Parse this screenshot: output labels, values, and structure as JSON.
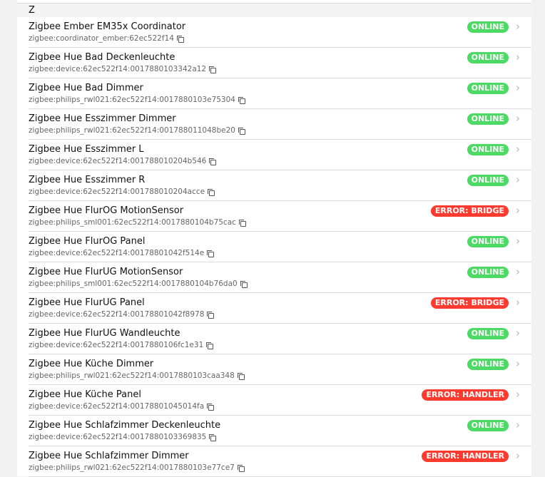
{
  "group_label": "Z",
  "colors": {
    "online": "#4cd964",
    "error": "#ff3b30"
  },
  "rows": [
    {
      "name": "Zigbee Ember EM35x Coordinator",
      "id": "zigbee:coordinator_ember:62ec522f14",
      "status": "ONLINE"
    },
    {
      "name": "Zigbee Hue Bad Deckenleuchte",
      "id": "zigbee:device:62ec522f14:0017880103342a12",
      "status": "ONLINE"
    },
    {
      "name": "Zigbee Hue Bad Dimmer",
      "id": "zigbee:philips_rwl021:62ec522f14:0017880103e75304",
      "status": "ONLINE"
    },
    {
      "name": "Zigbee Hue Esszimmer Dimmer",
      "id": "zigbee:philips_rwl021:62ec522f14:001788011048be20",
      "status": "ONLINE"
    },
    {
      "name": "Zigbee Hue Esszimmer L",
      "id": "zigbee:device:62ec522f14:001788010204b546",
      "status": "ONLINE"
    },
    {
      "name": "Zigbee Hue Esszimmer R",
      "id": "zigbee:device:62ec522f14:001788010204acce",
      "status": "ONLINE"
    },
    {
      "name": "Zigbee Hue FlurOG MotionSensor",
      "id": "zigbee:philips_sml001:62ec522f14:0017880104b75cac",
      "status": "ERROR: BRIDGE"
    },
    {
      "name": "Zigbee Hue FlurOG Panel",
      "id": "zigbee:device:62ec522f14:00178801042f514e",
      "status": "ONLINE"
    },
    {
      "name": "Zigbee Hue FlurUG MotionSensor",
      "id": "zigbee:philips_sml001:62ec522f14:0017880104b76da0",
      "status": "ONLINE"
    },
    {
      "name": "Zigbee Hue FlurUG Panel",
      "id": "zigbee:device:62ec522f14:00178801042f8978",
      "status": "ERROR: BRIDGE"
    },
    {
      "name": "Zigbee Hue FlurUG Wandleuchte",
      "id": "zigbee:device:62ec522f14:0017880106fc1e31",
      "status": "ONLINE"
    },
    {
      "name": "Zigbee Hue Küche Dimmer",
      "id": "zigbee:philips_rwl021:62ec522f14:0017880103caa348",
      "status": "ONLINE"
    },
    {
      "name": "Zigbee Hue Küche Panel",
      "id": "zigbee:device:62ec522f14:00178801045014fa",
      "status": "ERROR: HANDLER"
    },
    {
      "name": "Zigbee Hue Schlafzimmer Deckenleuchte",
      "id": "zigbee:device:62ec522f14:0017880103369835",
      "status": "ONLINE"
    },
    {
      "name": "Zigbee Hue Schlafzimmer Dimmer",
      "id": "zigbee:philips_rwl021:62ec522f14:0017880103e77ce7",
      "status": "ERROR: HANDLER"
    }
  ]
}
